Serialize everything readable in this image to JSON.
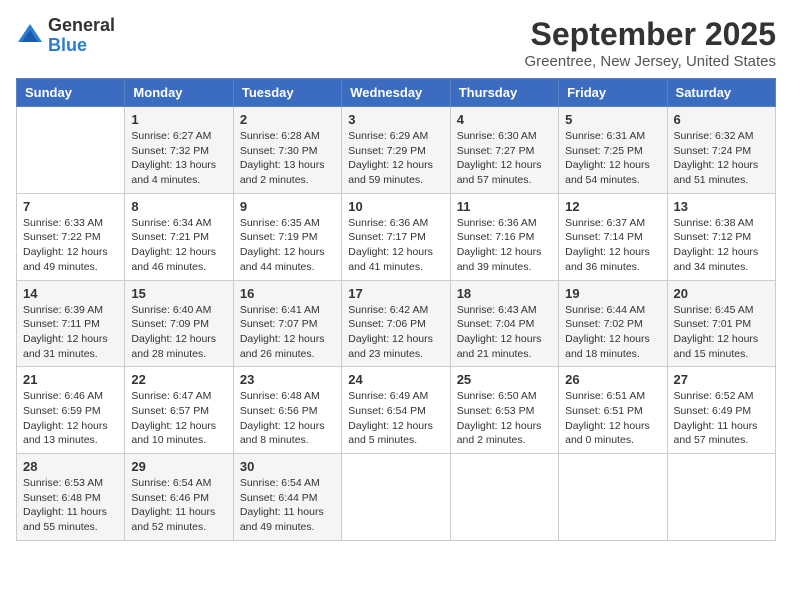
{
  "logo": {
    "general": "General",
    "blue": "Blue"
  },
  "title": "September 2025",
  "location": "Greentree, New Jersey, United States",
  "weekdays": [
    "Sunday",
    "Monday",
    "Tuesday",
    "Wednesday",
    "Thursday",
    "Friday",
    "Saturday"
  ],
  "weeks": [
    [
      {
        "num": "",
        "info": ""
      },
      {
        "num": "1",
        "info": "Sunrise: 6:27 AM\nSunset: 7:32 PM\nDaylight: 13 hours\nand 4 minutes."
      },
      {
        "num": "2",
        "info": "Sunrise: 6:28 AM\nSunset: 7:30 PM\nDaylight: 13 hours\nand 2 minutes."
      },
      {
        "num": "3",
        "info": "Sunrise: 6:29 AM\nSunset: 7:29 PM\nDaylight: 12 hours\nand 59 minutes."
      },
      {
        "num": "4",
        "info": "Sunrise: 6:30 AM\nSunset: 7:27 PM\nDaylight: 12 hours\nand 57 minutes."
      },
      {
        "num": "5",
        "info": "Sunrise: 6:31 AM\nSunset: 7:25 PM\nDaylight: 12 hours\nand 54 minutes."
      },
      {
        "num": "6",
        "info": "Sunrise: 6:32 AM\nSunset: 7:24 PM\nDaylight: 12 hours\nand 51 minutes."
      }
    ],
    [
      {
        "num": "7",
        "info": "Sunrise: 6:33 AM\nSunset: 7:22 PM\nDaylight: 12 hours\nand 49 minutes."
      },
      {
        "num": "8",
        "info": "Sunrise: 6:34 AM\nSunset: 7:21 PM\nDaylight: 12 hours\nand 46 minutes."
      },
      {
        "num": "9",
        "info": "Sunrise: 6:35 AM\nSunset: 7:19 PM\nDaylight: 12 hours\nand 44 minutes."
      },
      {
        "num": "10",
        "info": "Sunrise: 6:36 AM\nSunset: 7:17 PM\nDaylight: 12 hours\nand 41 minutes."
      },
      {
        "num": "11",
        "info": "Sunrise: 6:36 AM\nSunset: 7:16 PM\nDaylight: 12 hours\nand 39 minutes."
      },
      {
        "num": "12",
        "info": "Sunrise: 6:37 AM\nSunset: 7:14 PM\nDaylight: 12 hours\nand 36 minutes."
      },
      {
        "num": "13",
        "info": "Sunrise: 6:38 AM\nSunset: 7:12 PM\nDaylight: 12 hours\nand 34 minutes."
      }
    ],
    [
      {
        "num": "14",
        "info": "Sunrise: 6:39 AM\nSunset: 7:11 PM\nDaylight: 12 hours\nand 31 minutes."
      },
      {
        "num": "15",
        "info": "Sunrise: 6:40 AM\nSunset: 7:09 PM\nDaylight: 12 hours\nand 28 minutes."
      },
      {
        "num": "16",
        "info": "Sunrise: 6:41 AM\nSunset: 7:07 PM\nDaylight: 12 hours\nand 26 minutes."
      },
      {
        "num": "17",
        "info": "Sunrise: 6:42 AM\nSunset: 7:06 PM\nDaylight: 12 hours\nand 23 minutes."
      },
      {
        "num": "18",
        "info": "Sunrise: 6:43 AM\nSunset: 7:04 PM\nDaylight: 12 hours\nand 21 minutes."
      },
      {
        "num": "19",
        "info": "Sunrise: 6:44 AM\nSunset: 7:02 PM\nDaylight: 12 hours\nand 18 minutes."
      },
      {
        "num": "20",
        "info": "Sunrise: 6:45 AM\nSunset: 7:01 PM\nDaylight: 12 hours\nand 15 minutes."
      }
    ],
    [
      {
        "num": "21",
        "info": "Sunrise: 6:46 AM\nSunset: 6:59 PM\nDaylight: 12 hours\nand 13 minutes."
      },
      {
        "num": "22",
        "info": "Sunrise: 6:47 AM\nSunset: 6:57 PM\nDaylight: 12 hours\nand 10 minutes."
      },
      {
        "num": "23",
        "info": "Sunrise: 6:48 AM\nSunset: 6:56 PM\nDaylight: 12 hours\nand 8 minutes."
      },
      {
        "num": "24",
        "info": "Sunrise: 6:49 AM\nSunset: 6:54 PM\nDaylight: 12 hours\nand 5 minutes."
      },
      {
        "num": "25",
        "info": "Sunrise: 6:50 AM\nSunset: 6:53 PM\nDaylight: 12 hours\nand 2 minutes."
      },
      {
        "num": "26",
        "info": "Sunrise: 6:51 AM\nSunset: 6:51 PM\nDaylight: 12 hours\nand 0 minutes."
      },
      {
        "num": "27",
        "info": "Sunrise: 6:52 AM\nSunset: 6:49 PM\nDaylight: 11 hours\nand 57 minutes."
      }
    ],
    [
      {
        "num": "28",
        "info": "Sunrise: 6:53 AM\nSunset: 6:48 PM\nDaylight: 11 hours\nand 55 minutes."
      },
      {
        "num": "29",
        "info": "Sunrise: 6:54 AM\nSunset: 6:46 PM\nDaylight: 11 hours\nand 52 minutes."
      },
      {
        "num": "30",
        "info": "Sunrise: 6:54 AM\nSunset: 6:44 PM\nDaylight: 11 hours\nand 49 minutes."
      },
      {
        "num": "",
        "info": ""
      },
      {
        "num": "",
        "info": ""
      },
      {
        "num": "",
        "info": ""
      },
      {
        "num": "",
        "info": ""
      }
    ]
  ]
}
